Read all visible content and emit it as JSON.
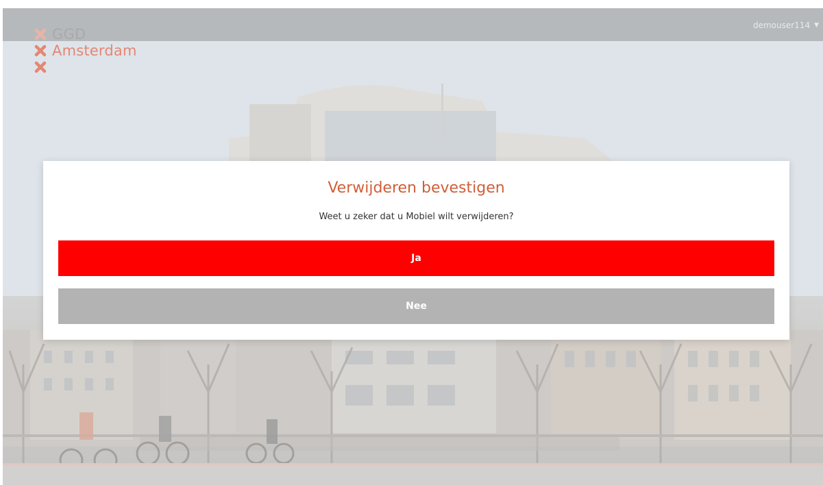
{
  "header": {
    "logo": {
      "line1": "GGD",
      "line2": "Amsterdam"
    },
    "user_menu": {
      "username": "demouser114",
      "caret_icon": "chevron-down-icon"
    }
  },
  "dialog": {
    "title": "Verwijderen bevestigen",
    "message": "Weet u zeker dat u Mobiel wilt verwijderen?",
    "confirm_label": "Ja",
    "cancel_label": "Nee"
  },
  "colors": {
    "title": "#cf5f38",
    "confirm": "#ff0000",
    "cancel": "#b3b3b3",
    "logo_accent": "#e48773"
  }
}
